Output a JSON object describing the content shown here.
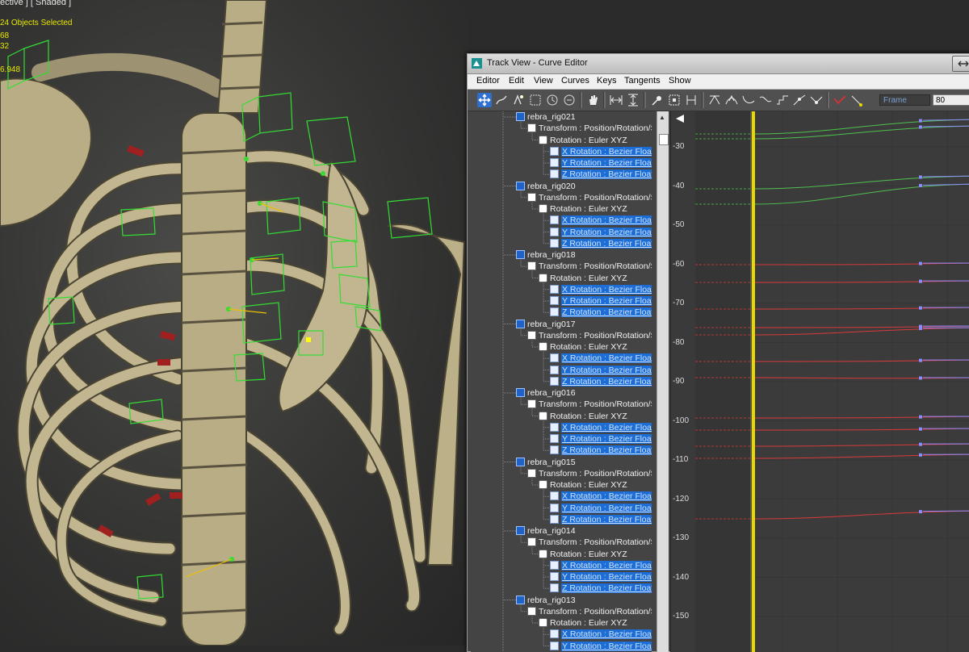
{
  "viewport": {
    "label": "ective ] [ Shaded ]",
    "stats": [
      "24 Objects Selected",
      "68",
      "32",
      "6.948"
    ]
  },
  "trackview": {
    "title": "Track View - Curve Editor",
    "menu": [
      "Editor",
      "Edit",
      "View",
      "Curves",
      "Keys",
      "Tangents",
      "Show"
    ],
    "toolbar": {
      "icons": [
        "move-keys-icon",
        "draw-curves-icon",
        "insert-keys-icon",
        "region-icon",
        "retime-icon",
        "retime-all-icon",
        "pan-icon",
        "frame-horizontal-icon",
        "frame-value-icon",
        "isolate-curve-icon",
        "show-keys-icon",
        "slow-tangent-icon",
        "fast-tangent-icon",
        "smooth-tangent-icon",
        "linear-tangent-icon",
        "step-tangent-icon",
        "custom-tangent-icon",
        "auto-tangent-icon",
        "break-tangent-icon",
        "unify-tangent-icon",
        "show-tangents-icon",
        "lock-tangents-icon"
      ],
      "frame_label": "Frame",
      "frame_value": "80"
    },
    "tree": [
      {
        "name": "rebra_rig021",
        "transform": "Transform : Position/Rotation/Sc",
        "rotation": "Rotation : Euler XYZ",
        "tracks": [
          "X Rotation : Bezier Float",
          "Y Rotation : Bezier Float",
          "Z Rotation : Bezier Float"
        ]
      },
      {
        "name": "rebra_rig020",
        "transform": "Transform : Position/Rotation/Sc",
        "rotation": "Rotation : Euler XYZ",
        "tracks": [
          "X Rotation : Bezier Float",
          "Y Rotation : Bezier Float",
          "Z Rotation : Bezier Float"
        ]
      },
      {
        "name": "rebra_rig018",
        "transform": "Transform : Position/Rotation/Sc",
        "rotation": "Rotation : Euler XYZ",
        "tracks": [
          "X Rotation : Bezier Float",
          "Y Rotation : Bezier Float",
          "Z Rotation : Bezier Float"
        ]
      },
      {
        "name": "rebra_rig017",
        "transform": "Transform : Position/Rotation/Sc",
        "rotation": "Rotation : Euler XYZ",
        "tracks": [
          "X Rotation : Bezier Float",
          "Y Rotation : Bezier Float",
          "Z Rotation : Bezier Float"
        ]
      },
      {
        "name": "rebra_rig016",
        "transform": "Transform : Position/Rotation/Sc",
        "rotation": "Rotation : Euler XYZ",
        "tracks": [
          "X Rotation : Bezier Float",
          "Y Rotation : Bezier Float",
          "Z Rotation : Bezier Float"
        ]
      },
      {
        "name": "rebra_rig015",
        "transform": "Transform : Position/Rotation/Sc",
        "rotation": "Rotation : Euler XYZ",
        "tracks": [
          "X Rotation : Bezier Float",
          "Y Rotation : Bezier Float",
          "Z Rotation : Bezier Float"
        ]
      },
      {
        "name": "rebra_rig014",
        "transform": "Transform : Position/Rotation/Sc",
        "rotation": "Rotation : Euler XYZ",
        "tracks": [
          "X Rotation : Bezier Float",
          "Y Rotation : Bezier Float",
          "Z Rotation : Bezier Float"
        ]
      },
      {
        "name": "rebra_rig013",
        "transform": "Transform : Position/Rotation/Sc",
        "rotation": "Rotation : Euler XYZ",
        "tracks": [
          "X Rotation : Bezier Float",
          "Y Rotation : Bezier Float"
        ]
      }
    ],
    "graph": {
      "y_ticks": [
        "-30",
        "-40",
        "-50",
        "-60",
        "-70",
        "-80",
        "-90",
        "-100",
        "-110",
        "-120",
        "-130",
        "-140",
        "-150"
      ],
      "colors": {
        "x_curve": "#d83a3a",
        "y_curve": "#4fc04f",
        "z_curve": "#6a6aff",
        "time_slider": "#e8d800",
        "key": "#8c8cff"
      }
    }
  }
}
